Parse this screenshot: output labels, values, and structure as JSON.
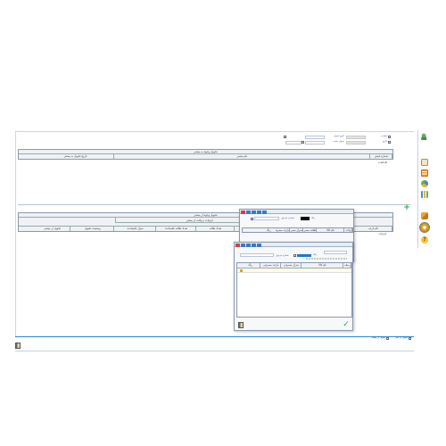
{
  "window": {
    "accent": "#1e78c8",
    "status_color": "#2b8cd4"
  },
  "form": {
    "field_labels": [
      "شماره",
      "تاریخ",
      "تاریخ تحویل",
      "تحویل دهنده",
      "مبلغ",
      "کد"
    ],
    "date_from": "",
    "date_to": ""
  },
  "top_section": {
    "title": "تحویل وجوه به بیشتر",
    "columns": [
      "شماره فیش",
      "نام بیشتر",
      "تاریخ تحویل به بیشتر",
      "اقدامات"
    ]
  },
  "bottom_section": {
    "title": "تحویل وجوه از بیشتر",
    "subtitle": "جزئیات دریافت از بیشتر",
    "columns": [
      "نام بارچه",
      "واحد",
      "مقدار",
      "تعداد طاقه",
      "تعداد طاقه باقیمانده",
      "متراژ باقیمانده",
      "وضعیت تحویل",
      "تحویل از بیشتر",
      "جزئیات"
    ]
  },
  "dialog1": {
    "label_a": "رنگ",
    "label_b": "شماره فرمول",
    "columns": [
      "واحد",
      "نام کالا",
      "طاقه مصرفی",
      "متراژ مصرفی",
      "بارچه مصرفی",
      "رنگ"
    ]
  },
  "dialog2": {
    "label_a": "رنگ",
    "label_b": "شماره فرمول",
    "columns": [
      "ردیف",
      "نام کالا",
      "متراژ مصرفی",
      "بارچه مصرفی",
      "رنگ",
      "انتخاب"
    ],
    "ok_icon": "check-icon",
    "exit_icon": "exit-door-icon"
  },
  "footer": {
    "checkbox1_label": "تحویل از بیشتر",
    "checkbox2_label": "تحویل از انبار",
    "add_icon": "plus-icon"
  },
  "sidebar": {
    "icons": [
      "person-search-icon",
      "calendar-icon",
      "grid-icon",
      "chart-pie-icon",
      "bar-chart-icon",
      "hand-icon",
      "gear-icon",
      "help-icon"
    ]
  }
}
